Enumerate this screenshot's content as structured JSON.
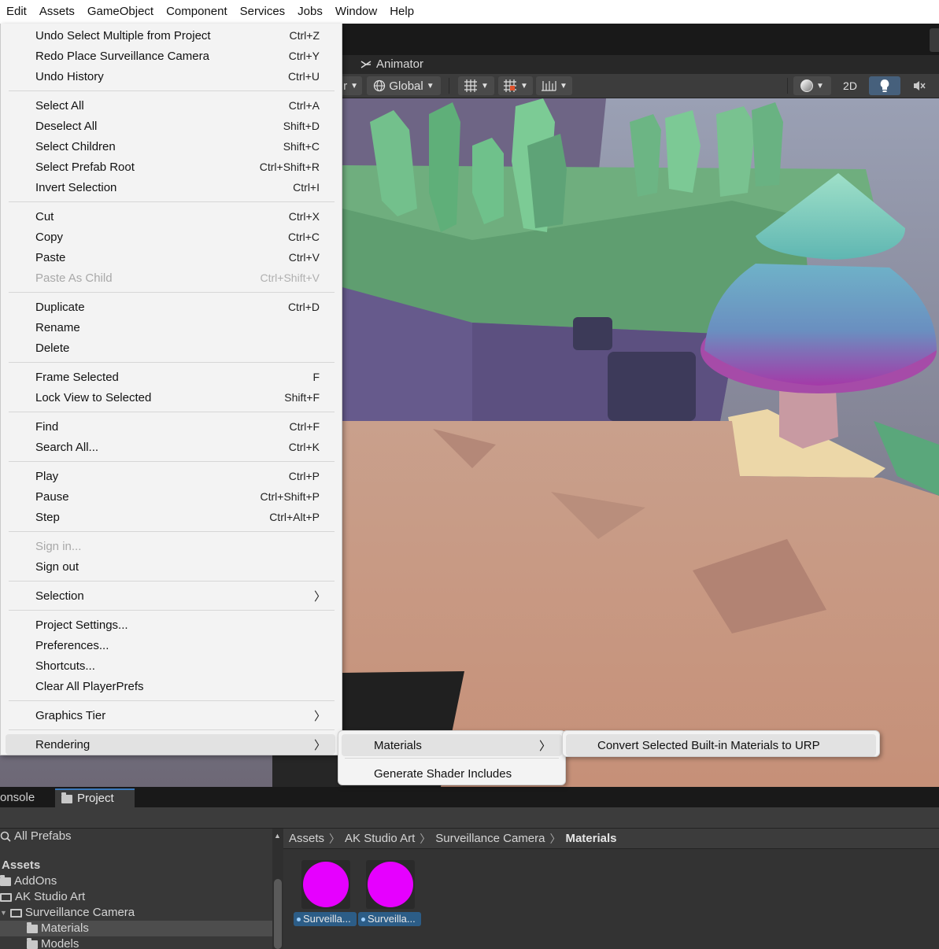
{
  "menubar": {
    "items": [
      "Edit",
      "Assets",
      "GameObject",
      "Component",
      "Services",
      "Jobs",
      "Window",
      "Help"
    ]
  },
  "editor": {
    "animator_tab": "Animator",
    "toolbar": {
      "pivot_partial": "r",
      "global_label": "Global",
      "mode_2d": "2D"
    }
  },
  "edit_menu": {
    "groups": [
      [
        {
          "label": "Undo Select Multiple from Project",
          "shortcut": "Ctrl+Z"
        },
        {
          "label": "Redo Place Surveillance Camera",
          "shortcut": "Ctrl+Y"
        },
        {
          "label": "Undo History",
          "shortcut": "Ctrl+U"
        }
      ],
      [
        {
          "label": "Select All",
          "shortcut": "Ctrl+A"
        },
        {
          "label": "Deselect All",
          "shortcut": "Shift+D"
        },
        {
          "label": "Select Children",
          "shortcut": "Shift+C"
        },
        {
          "label": "Select Prefab Root",
          "shortcut": "Ctrl+Shift+R"
        },
        {
          "label": "Invert Selection",
          "shortcut": "Ctrl+I"
        }
      ],
      [
        {
          "label": "Cut",
          "shortcut": "Ctrl+X"
        },
        {
          "label": "Copy",
          "shortcut": "Ctrl+C"
        },
        {
          "label": "Paste",
          "shortcut": "Ctrl+V"
        },
        {
          "label": "Paste As Child",
          "shortcut": "Ctrl+Shift+V",
          "disabled": true
        }
      ],
      [
        {
          "label": "Duplicate",
          "shortcut": "Ctrl+D"
        },
        {
          "label": "Rename",
          "shortcut": ""
        },
        {
          "label": "Delete",
          "shortcut": ""
        }
      ],
      [
        {
          "label": "Frame Selected",
          "shortcut": "F"
        },
        {
          "label": "Lock View to Selected",
          "shortcut": "Shift+F"
        }
      ],
      [
        {
          "label": "Find",
          "shortcut": "Ctrl+F"
        },
        {
          "label": "Search All...",
          "shortcut": "Ctrl+K"
        }
      ],
      [
        {
          "label": "Play",
          "shortcut": "Ctrl+P"
        },
        {
          "label": "Pause",
          "shortcut": "Ctrl+Shift+P"
        },
        {
          "label": "Step",
          "shortcut": "Ctrl+Alt+P"
        }
      ],
      [
        {
          "label": "Sign in...",
          "shortcut": "",
          "disabled": true
        },
        {
          "label": "Sign out",
          "shortcut": ""
        }
      ],
      [
        {
          "label": "Selection",
          "shortcut": "",
          "submenu": true
        }
      ],
      [
        {
          "label": "Project Settings...",
          "shortcut": ""
        },
        {
          "label": "Preferences...",
          "shortcut": ""
        },
        {
          "label": "Shortcuts...",
          "shortcut": ""
        },
        {
          "label": "Clear All PlayerPrefs",
          "shortcut": ""
        }
      ],
      [
        {
          "label": "Graphics Tier",
          "shortcut": "",
          "submenu": true
        }
      ],
      [
        {
          "label": "Rendering",
          "shortcut": "",
          "submenu": true,
          "highlighted": true
        }
      ]
    ]
  },
  "rendering_submenu": {
    "items": [
      {
        "label": "Materials",
        "submenu": true,
        "highlighted": true
      },
      {
        "label": "Generate Shader Includes",
        "submenu": false
      }
    ]
  },
  "materials_submenu": {
    "items": [
      {
        "label": "Convert Selected Built-in Materials to URP",
        "highlighted": true
      }
    ]
  },
  "bottom_panel": {
    "tabs": {
      "console_partial": "onsole",
      "project": "Project"
    },
    "tree": {
      "search_label": "All Prefabs",
      "root": "Assets",
      "items": [
        {
          "label": "AddOns",
          "depth": 0
        },
        {
          "label": "AK Studio Art",
          "depth": 0
        },
        {
          "label": "Surveillance Camera",
          "depth": 1
        },
        {
          "label": "Materials",
          "depth": 2,
          "selected": true
        },
        {
          "label": "Models",
          "depth": 2
        }
      ]
    },
    "breadcrumb": [
      "Assets",
      "AK Studio Art",
      "Surveillance Camera",
      "Materials"
    ],
    "assets": [
      {
        "label": "Surveilla...",
        "color": "#e600ff"
      },
      {
        "label": "Surveilla...",
        "color": "#e600ff"
      }
    ]
  }
}
